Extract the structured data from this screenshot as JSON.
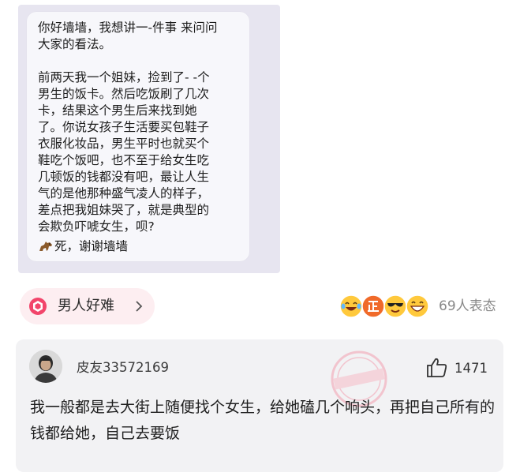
{
  "post": {
    "body": "你好墙墙，我想讲一-件事 来问问\n大家的看法。\n\n前两天我一个姐妹，捡到了- -个\n男生的饭卡。然后吃饭刷了几次\n卡，结果这个男生后来找到她\n了。你说女孩子生活要买包鞋子\n衣服化妆品，男生平时也就买个\n鞋吃个饭吧，也不至于给女生吃\n几顿饭的钱都没有吧，最让人生\n气的是他那种盛气凌人的样子，\n差点把我姐妹哭了，就是典型的\n会欺负吓唬女生，呗?",
    "closing": "死，谢谢墙墙",
    "closing_icon": "horse-emoji-icon"
  },
  "topic": {
    "label": "男人好难",
    "icon": "topic-hexagon-icon",
    "arrow_icon": "chevron-right-icon",
    "color": "#f2456b"
  },
  "reactions": {
    "icons": [
      "laughing-tears-emoji",
      "zheng-badge-emoji",
      "sunglasses-emoji",
      "grinning-emoji"
    ],
    "count_label": "69人表态"
  },
  "comment": {
    "username": "皮友33572169",
    "like_count": "1471",
    "text": "我一般都是去大街上随便找个女生，给她磕几个响头，再把自己所有的钱都给她，自己去要饭",
    "stamp_text": "一抽评"
  }
}
